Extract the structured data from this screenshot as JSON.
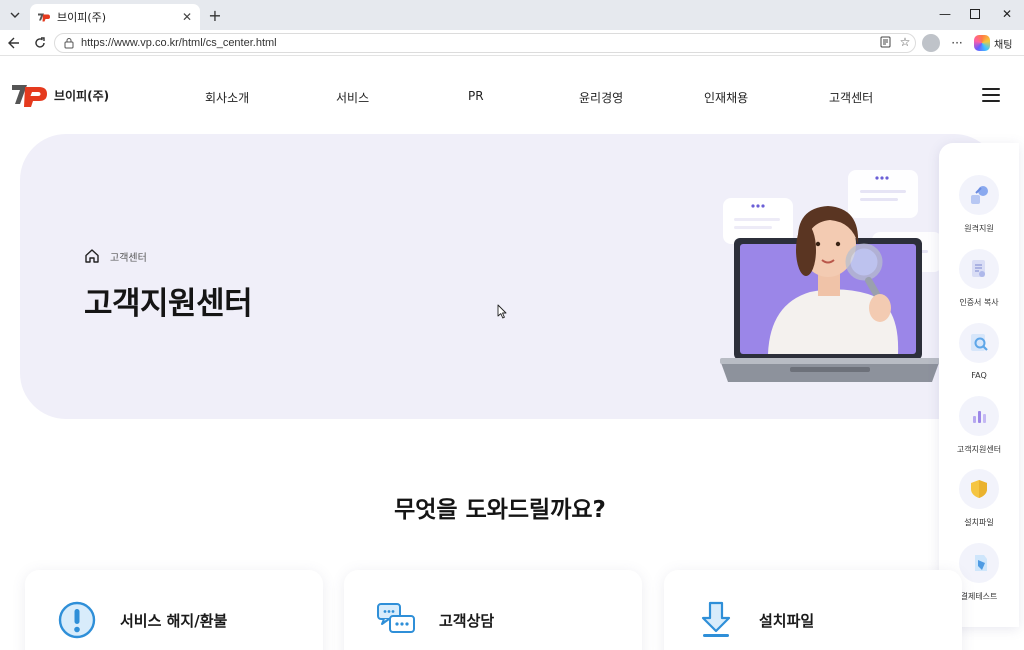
{
  "browser": {
    "tab_title": "브이피(주)",
    "url": "https://www.vp.co.kr/html/cs_center.html",
    "copilot_label": "채팅",
    "icons": [
      "tab-list-icon",
      "close-icon",
      "plus-icon",
      "minimize-icon",
      "maximize-icon",
      "back-icon",
      "reload-icon",
      "lock-icon",
      "reader-icon",
      "star-icon",
      "more-icon"
    ]
  },
  "header": {
    "logo_text": "브이피(주)",
    "nav": [
      "회사소개",
      "서비스",
      "PR",
      "윤리경영",
      "인재채용",
      "고객센터"
    ]
  },
  "hero": {
    "breadcrumb": "고객센터",
    "title": "고객지원센터"
  },
  "quick_menu": [
    {
      "label": "원격지원",
      "icon": "remote-support-icon"
    },
    {
      "label": "인증서 복사",
      "icon": "certificate-copy-icon"
    },
    {
      "label": "FAQ",
      "icon": "faq-search-icon"
    },
    {
      "label": "고객지원센터",
      "icon": "support-center-chart-icon"
    },
    {
      "label": "설치파일",
      "icon": "install-file-shield-icon"
    },
    {
      "label": "결제테스트",
      "icon": "payment-test-icon"
    }
  ],
  "section": {
    "title": "무엇을 도와드릴까요?",
    "cards": [
      {
        "label": "서비스 해지/환불",
        "icon": "exclamation-icon"
      },
      {
        "label": "고객상담",
        "icon": "chat-bubbles-icon"
      },
      {
        "label": "설치파일",
        "icon": "download-icon"
      }
    ]
  },
  "colors": {
    "hero_bg": "#f0eff9",
    "accent_blue": "#2f8fd8",
    "logo_red": "#e53a1e"
  }
}
